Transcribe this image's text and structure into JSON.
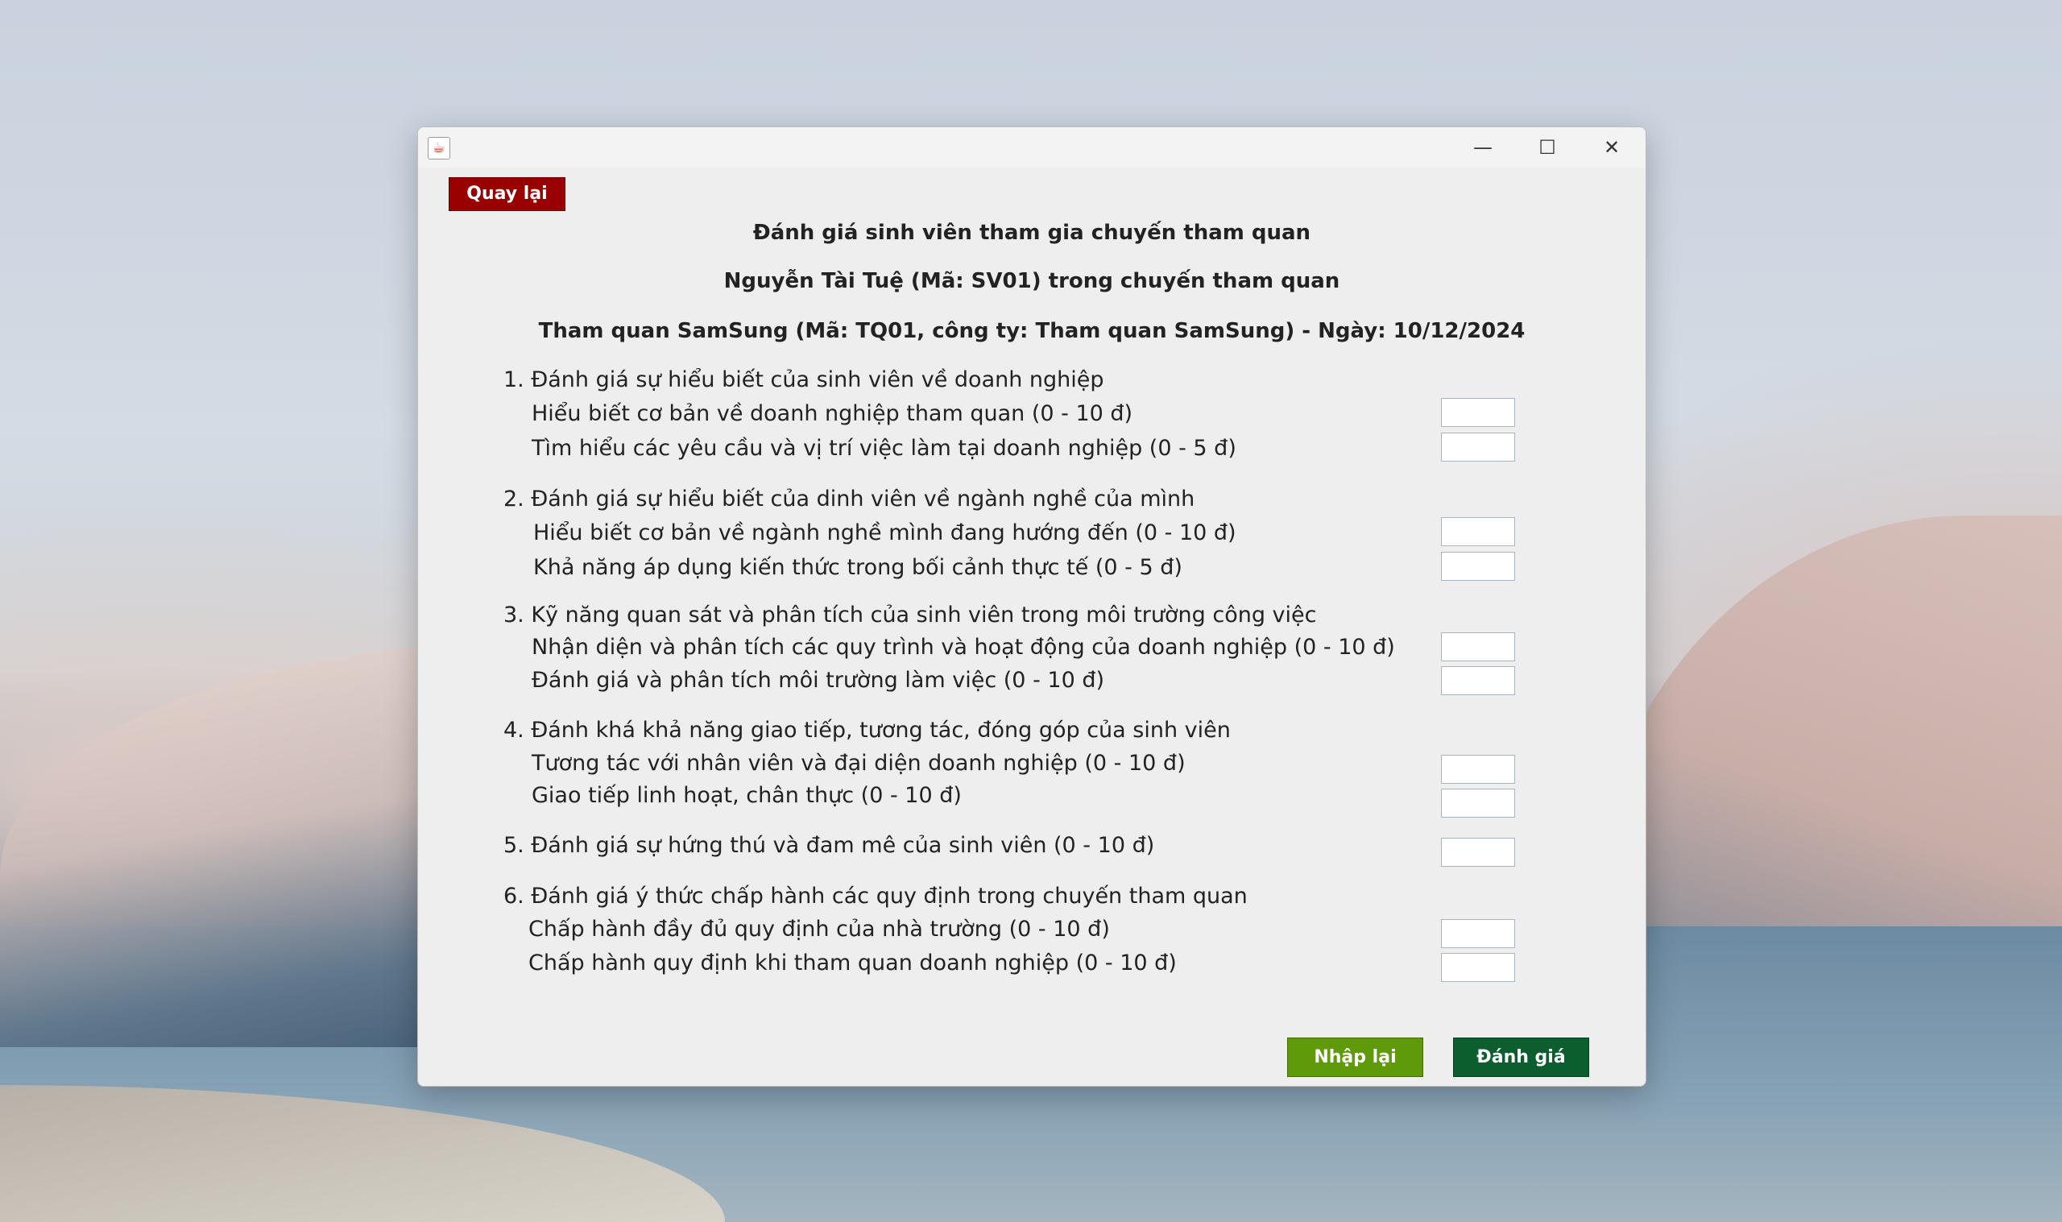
{
  "window": {
    "minimize_glyph": "—",
    "maximize_glyph": "☐",
    "close_glyph": "✕",
    "icon": "java-app-icon"
  },
  "buttons": {
    "back": "Quay lại",
    "reset": "Nhập lại",
    "submit": "Đánh giá"
  },
  "colors": {
    "back": "#990000",
    "reset": "#5f9a0a",
    "submit": "#0c5e2e"
  },
  "header": {
    "title": "Đánh giá sinh viên tham gia chuyến tham quan",
    "student": "Nguyễn Tài Tuệ (Mã: SV01) trong chuyến tham quan",
    "trip": "Tham quan SamSung (Mã: TQ01, công ty: Tham quan SamSung) - Ngày: 10/12/2024"
  },
  "sections": [
    {
      "title": "1. Đánh giá sự hiểu biết của sinh viên về doanh nghiệp",
      "criteria": [
        {
          "label": "Hiểu biết cơ bản về doanh nghiệp tham quan (0 - 10 đ)",
          "value": ""
        },
        {
          "label": "Tìm hiểu các yêu cầu và vị trí việc làm tại doanh nghiệp (0 - 5 đ)",
          "value": ""
        }
      ]
    },
    {
      "title": "2. Đánh giá sự hiểu biết của dinh viên về ngành nghề của mình",
      "criteria": [
        {
          "label": "Hiểu biết cơ bản về ngành nghề mình đang hướng đến (0 - 10 đ)",
          "value": ""
        },
        {
          "label": "Khả năng áp dụng kiến thức trong bối cảnh thực tế (0 - 5 đ)",
          "value": ""
        }
      ]
    },
    {
      "title": "3. Kỹ năng quan sát và phân tích của sinh viên trong môi trường công việc",
      "criteria": [
        {
          "label": "Nhận diện và phân tích các quy trình và hoạt động của doanh nghiệp (0 - 10 đ)",
          "value": ""
        },
        {
          "label": "Đánh giá và phân tích môi trường làm việc (0 - 10 đ)",
          "value": ""
        }
      ]
    },
    {
      "title": "4. Đánh khá khả năng giao tiếp, tương tác, đóng góp của sinh viên",
      "criteria": [
        {
          "label": "Tương tác với nhân viên và đại diện doanh nghiệp (0 - 10 đ)",
          "value": ""
        },
        {
          "label": "Giao tiếp linh hoạt, chân thực (0 - 10 đ)",
          "value": ""
        }
      ]
    },
    {
      "title": "5. Đánh giá sự hứng thú và đam mê của sinh viên (0 - 10 đ)",
      "value": ""
    },
    {
      "title": "6. Đánh giá ý thức chấp hành các quy định trong chuyến tham quan",
      "criteria": [
        {
          "label": "Chấp hành đầy đủ quy định của nhà trường (0 - 10 đ)",
          "value": ""
        },
        {
          "label": "Chấp hành quy định khi tham quan doanh nghiệp (0 - 10 đ)",
          "value": ""
        }
      ]
    }
  ]
}
